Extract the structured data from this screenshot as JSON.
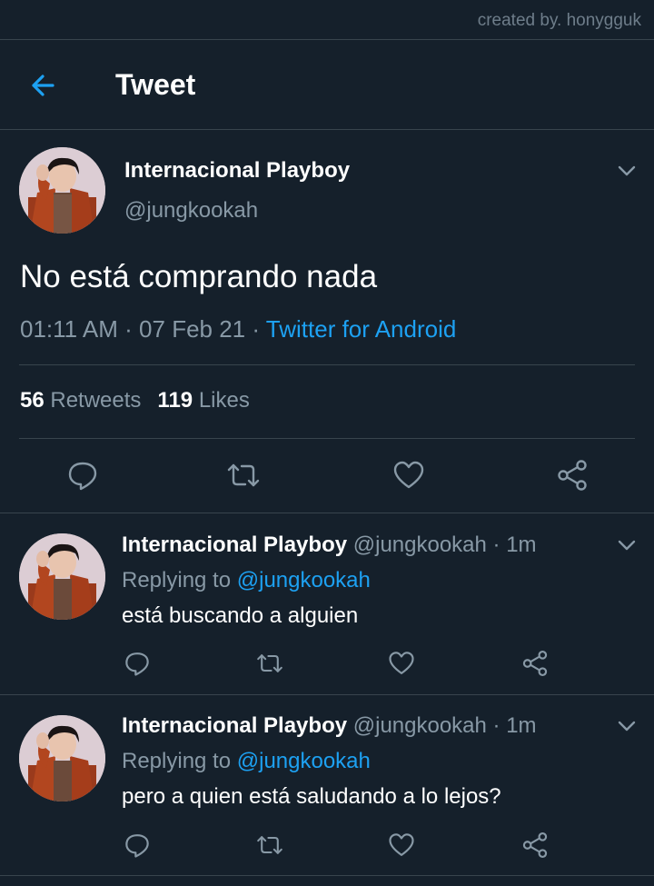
{
  "watermark": "created by. honygguk",
  "header": {
    "title": "Tweet",
    "back_icon": "arrow-left-icon"
  },
  "colors": {
    "background": "#15202b",
    "accent": "#1da1f2",
    "muted": "#8899a6",
    "divider": "#38444d"
  },
  "main_tweet": {
    "name": "Internacional Playboy",
    "handle": "@jungkookah",
    "text": "No está comprando nada",
    "time": "01:11 AM",
    "sep1": " · ",
    "date": "07 Feb 21",
    "sep2": " · ",
    "source": "Twitter for Android",
    "retweets_count": "56",
    "retweets_label": "Retweets",
    "likes_count": "119",
    "likes_label": "Likes",
    "actions": [
      "reply-icon",
      "retweet-icon",
      "like-icon",
      "share-icon"
    ]
  },
  "replies": [
    {
      "name": "Internacional Playboy",
      "handle_time": "@jungkookah · 1m",
      "replying_prefix": "Replying to",
      "replying_handle": "@jungkookah",
      "text": "está buscando a alguien"
    },
    {
      "name": "Internacional Playboy",
      "handle_time": "@jungkookah · 1m",
      "replying_prefix": "Replying to",
      "replying_handle": "@jungkookah",
      "text": "pero a quien está saludando a lo lejos?"
    }
  ]
}
